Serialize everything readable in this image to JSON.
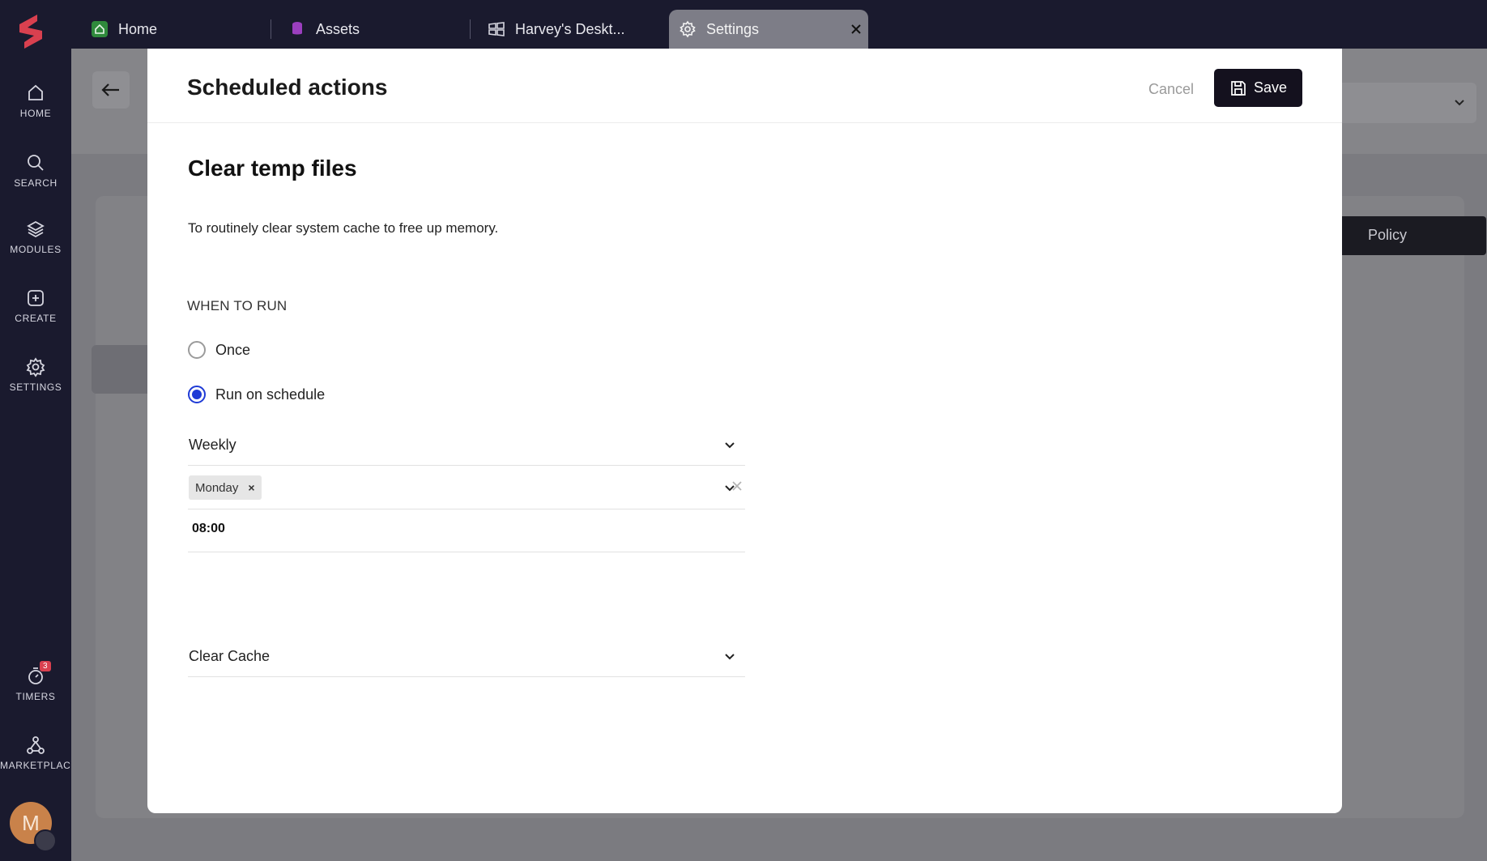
{
  "nav": {
    "items": [
      {
        "label": "HOME",
        "icon": "home-icon"
      },
      {
        "label": "SEARCH",
        "icon": "search-icon"
      },
      {
        "label": "MODULES",
        "icon": "layers-icon"
      },
      {
        "label": "CREATE",
        "icon": "plus-square-icon"
      },
      {
        "label": "SETTINGS",
        "icon": "gear-icon"
      },
      {
        "label": "TIMERS",
        "icon": "timer-icon",
        "badge": "3"
      },
      {
        "label": "MARKETPLACE",
        "icon": "network-icon"
      }
    ],
    "avatar_initial": "M"
  },
  "tabs": [
    {
      "label": "Home",
      "icon": "home-icon"
    },
    {
      "label": "Assets",
      "icon": "database-icon"
    },
    {
      "label": "Harvey's Deskt...",
      "icon": "windows-icon"
    },
    {
      "label": "Settings",
      "icon": "gear-icon",
      "active": true
    }
  ],
  "background": {
    "policy_button": "Policy"
  },
  "modal": {
    "title": "Scheduled actions",
    "cancel_label": "Cancel",
    "save_label": "Save",
    "action_name": "Clear temp files",
    "description": "To routinely clear system cache to free up memory.",
    "when_to_run_label": "WHEN TO RUN",
    "options": {
      "once": "Once",
      "schedule": "Run on schedule",
      "selected": "Run on schedule"
    },
    "frequency": "Weekly",
    "days": [
      "Monday"
    ],
    "time": "08:00",
    "action": "Clear Cache"
  },
  "colors": {
    "accent": "#1f3bd6",
    "primary_button": "#14111e",
    "rail": "#1a1a2e",
    "brand": "#d9404f"
  }
}
